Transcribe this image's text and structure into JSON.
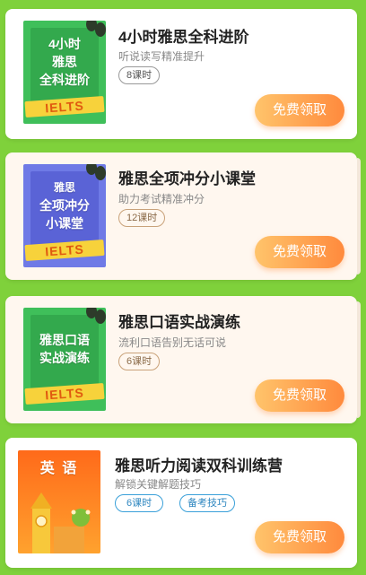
{
  "cards": [
    {
      "cover_lines": [
        "4小时",
        "雅思",
        "全科进阶"
      ],
      "cover_ribbon": "IELTS",
      "title": "4小时雅思全科进阶",
      "subtitle": "听说读写精准提升",
      "tags": [
        "8课时"
      ],
      "button": "免费领取",
      "cover_color": "#3fbf5a",
      "inner_color": "#33a94d"
    },
    {
      "cover_lines": [
        "雅思",
        "全项冲分",
        "小课堂"
      ],
      "cover_ribbon": "IELTS",
      "title": "雅思全项冲分小课堂",
      "subtitle": "助力考试精准冲分",
      "tags": [
        "12课时"
      ],
      "button": "免费领取",
      "cover_color": "#6f7ae6",
      "inner_color": "#5a63d6"
    },
    {
      "cover_lines": [
        "雅思口语",
        "实战演练"
      ],
      "cover_ribbon": "IELTS",
      "title": "雅思口语实战演练",
      "subtitle": "流利口语告别无话可说",
      "tags": [
        "6课时"
      ],
      "button": "免费领取",
      "cover_color": "#3fbf5a",
      "inner_color": "#33a94d"
    },
    {
      "cover_lines": [
        "英 语"
      ],
      "title": "雅思听力阅读双科训练营",
      "subtitle": "解锁关键解题技巧",
      "tags": [
        "6课时",
        "备考技巧"
      ],
      "button": "免费领取",
      "cover_color": "#ff7a1a"
    }
  ]
}
